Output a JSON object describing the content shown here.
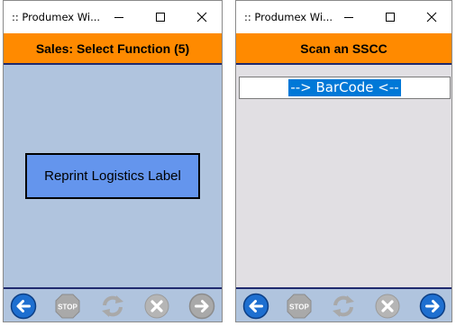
{
  "colors": {
    "header_orange": "#ff8a00",
    "header_border_navy": "#1f2a6e",
    "content_left_bg": "#b0c4de",
    "content_right_bg": "#e1dfe3",
    "button_blue": "#6495ed",
    "selection_blue": "#0078d7",
    "nav_blue": "#1e6fd0",
    "disabled_grey": "#a9a9a9"
  },
  "window_left": {
    "title": ":: Produmex Wi...",
    "header": "Sales: Select Function (5)",
    "function_button_label": "Reprint Logistics Label",
    "footer_icons": [
      {
        "name": "back-arrow-icon",
        "state": "enabled"
      },
      {
        "name": "stop-icon",
        "label": "STOP",
        "state": "disabled"
      },
      {
        "name": "refresh-icon",
        "state": "disabled"
      },
      {
        "name": "cancel-icon",
        "state": "disabled"
      },
      {
        "name": "forward-arrow-icon",
        "state": "disabled"
      }
    ]
  },
  "window_right": {
    "title": ":: Produmex Wi...",
    "header": "Scan an SSCC",
    "barcode_input_value": "--> BarCode <--",
    "footer_icons": [
      {
        "name": "back-arrow-icon",
        "state": "enabled"
      },
      {
        "name": "stop-icon",
        "label": "STOP",
        "state": "disabled"
      },
      {
        "name": "refresh-icon",
        "state": "disabled"
      },
      {
        "name": "cancel-icon",
        "state": "disabled"
      },
      {
        "name": "forward-arrow-icon",
        "state": "enabled"
      }
    ]
  }
}
